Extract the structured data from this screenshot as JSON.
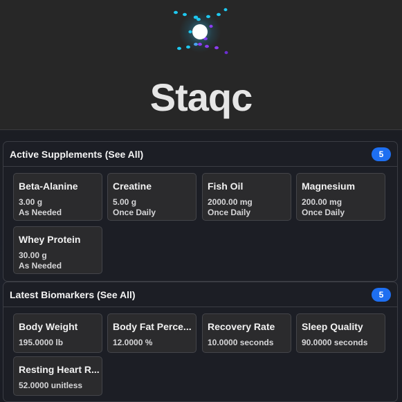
{
  "header": {
    "brand": "Staqc",
    "logo_icon": "particle-orb-icon",
    "colors": {
      "cyan": "#1ec8f0",
      "purple": "#8a3df0",
      "core": "#ffffff"
    }
  },
  "supplements": {
    "title": "Active Supplements (See All)",
    "count": "5",
    "items": [
      {
        "name": "Beta-Alanine",
        "dose": "3.00 g",
        "frequency": "As Needed"
      },
      {
        "name": "Creatine",
        "dose": "5.00 g",
        "frequency": "Once Daily"
      },
      {
        "name": "Fish Oil",
        "dose": "2000.00 mg",
        "frequency": "Once Daily"
      },
      {
        "name": "Magnesium",
        "dose": "200.00 mg",
        "frequency": "Once Daily"
      },
      {
        "name": "Whey Protein",
        "dose": "30.00 g",
        "frequency": "As Needed"
      }
    ]
  },
  "biomarkers": {
    "title": "Latest Biomarkers (See All)",
    "count": "5",
    "items": [
      {
        "name": "Body Weight",
        "value": "195.0000 lb"
      },
      {
        "name": "Body Fat Perce...",
        "value": "12.0000 %"
      },
      {
        "name": "Recovery Rate",
        "value": "10.0000 seconds"
      },
      {
        "name": "Sleep Quality",
        "value": "90.0000 seconds"
      },
      {
        "name": "Resting Heart R...",
        "value": "52.0000 unitless"
      }
    ]
  },
  "accent_color": "#1e6ff1"
}
